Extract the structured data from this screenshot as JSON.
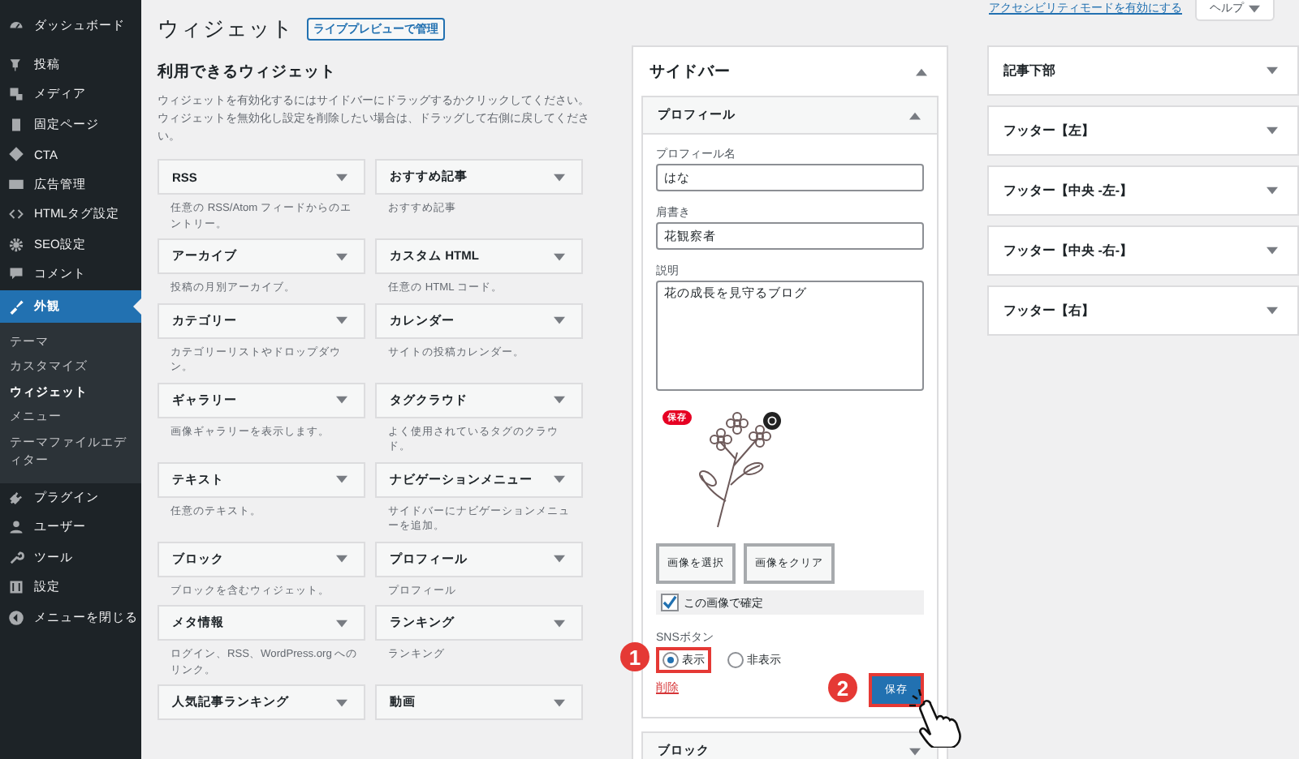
{
  "sidebar": {
    "items": [
      {
        "label": "ダッシュボード",
        "selected": false
      },
      {
        "label": "投稿",
        "selected": false
      },
      {
        "label": "メディア",
        "selected": false
      },
      {
        "label": "固定ページ",
        "selected": false
      },
      {
        "label": "CTA",
        "selected": false
      },
      {
        "label": "広告管理",
        "selected": false
      },
      {
        "label": "HTMLタグ設定",
        "selected": false
      },
      {
        "label": "SEO設定",
        "selected": false
      },
      {
        "label": "コメント",
        "selected": false
      },
      {
        "label": "外観",
        "selected": true,
        "children": [
          {
            "label": "テーマ",
            "selected": false
          },
          {
            "label": "カスタマイズ",
            "selected": false
          },
          {
            "label": "ウィジェット",
            "selected": true
          },
          {
            "label": "メニュー",
            "selected": false
          },
          {
            "label": "テーマファイルエディター",
            "selected": false
          }
        ]
      },
      {
        "label": "プラグイン",
        "selected": false
      },
      {
        "label": "ユーザー",
        "selected": false
      },
      {
        "label": "ツール",
        "selected": false
      },
      {
        "label": "設定",
        "selected": false
      }
    ],
    "collapse_label": "メニューを閉じる"
  },
  "screen_meta": {
    "accessibility_link": "アクセシビリティモードを有効にする",
    "help_button": "ヘルプ"
  },
  "page_title": "ウィジェット",
  "live_preview_button": "ライブプレビューで管理",
  "available": {
    "title": "利用できるウィジェット",
    "description": "ウィジェットを有効化するにはサイドバーにドラッグするかクリックしてください。ウィジェットを無効化し設定を削除したい場合は、ドラッグして右側に戻してください。",
    "widgets": [
      {
        "name": "RSS",
        "description": "任意の RSS/Atom フィードからのエントリー。"
      },
      {
        "name": "おすすめ記事",
        "description": "おすすめ記事"
      },
      {
        "name": "アーカイブ",
        "description": "投稿の月別アーカイブ。"
      },
      {
        "name": "カスタム HTML",
        "description": "任意の HTML コード。"
      },
      {
        "name": "カテゴリー",
        "description": "カテゴリーリストやドロップダウン。"
      },
      {
        "name": "カレンダー",
        "description": "サイトの投稿カレンダー。"
      },
      {
        "name": "ギャラリー",
        "description": "画像ギャラリーを表示します。"
      },
      {
        "name": "タグクラウド",
        "description": "よく使用されているタグのクラウド。"
      },
      {
        "name": "テキスト",
        "description": "任意のテキスト。"
      },
      {
        "name": "ナビゲーションメニュー",
        "description": "サイドバーにナビゲーションメニューを追加。"
      },
      {
        "name": "ブロック",
        "description": "ブロックを含むウィジェット。"
      },
      {
        "name": "プロフィール",
        "description": "プロフィール"
      },
      {
        "name": "メタ情報",
        "description": "ログイン、RSS、WordPress.org へのリンク。"
      },
      {
        "name": "ランキング",
        "description": "ランキング"
      },
      {
        "name": "人気記事ランキング"
      },
      {
        "name": "動画"
      }
    ]
  },
  "sidebar_area": {
    "title": "サイドバー",
    "expanded": true,
    "widget": {
      "title": "プロフィール",
      "expanded": true,
      "fields": [
        {
          "kind": "text",
          "label": "プロフィール名",
          "value": "はな"
        },
        {
          "kind": "text",
          "label": "肩書き",
          "value": "花観察者"
        },
        {
          "kind": "textarea",
          "label": "説明",
          "value": "花の成長を見守るブログ"
        }
      ],
      "image_badge": "保存",
      "image_buttons": [
        "画像を選択",
        "画像をクリア"
      ],
      "confirm": {
        "label": "この画像で確定",
        "checked": true
      },
      "sns": {
        "label": "SNSボタン",
        "options": [
          {
            "label": "表示",
            "selected": true,
            "annotation": "1"
          },
          {
            "label": "非表示",
            "selected": false
          }
        ]
      },
      "delete_link": "削除",
      "save_button": {
        "label": "保存",
        "annotation": "2"
      }
    },
    "next_widget": "ブロック"
  },
  "areas": [
    "記事下部",
    "フッター【左】",
    "フッター【中央 -左-】",
    "フッター【中央 -右-】",
    "フッター【右】"
  ]
}
